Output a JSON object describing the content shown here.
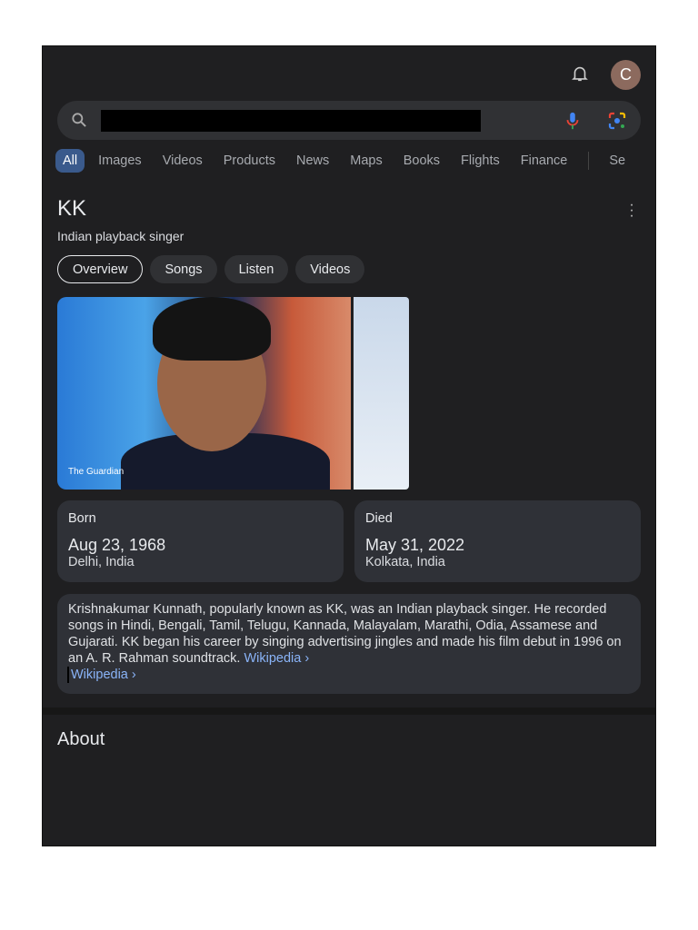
{
  "header": {
    "avatar_letter": "C"
  },
  "search": {
    "query": ""
  },
  "tabs": [
    "All",
    "Images",
    "Videos",
    "Products",
    "News",
    "Maps",
    "Books",
    "Flights",
    "Finance",
    "Se"
  ],
  "entity": {
    "title": "KK",
    "subtitle": "Indian playback singer",
    "chips": [
      "Overview",
      "Songs",
      "Listen",
      "Videos"
    ],
    "image_source": "The Guardian",
    "born": {
      "label": "Born",
      "date": "Aug 23, 1968",
      "place": "Delhi, India"
    },
    "died": {
      "label": "Died",
      "date": "May 31, 2022",
      "place": "Kolkata, India"
    },
    "description": "Krishnakumar Kunnath, popularly known as KK, was an Indian playback singer. He recorded songs in Hindi, Bengali, Tamil, Telugu, Kannada, Malayalam, Marathi, Odia, Assamese and Gujarati. KK began his career by singing advertising jingles and made his film debut in 1996 on an A. R. Rahman soundtrack.",
    "wiki_link": "Wikipedia ›",
    "wiki_link2": "Wikipedia ›"
  },
  "about_heading": "About",
  "colors": {
    "background": "#1f1f21",
    "card": "#2f3137",
    "link": "#8ab4f8",
    "active_tab": "#3a5a8c"
  }
}
